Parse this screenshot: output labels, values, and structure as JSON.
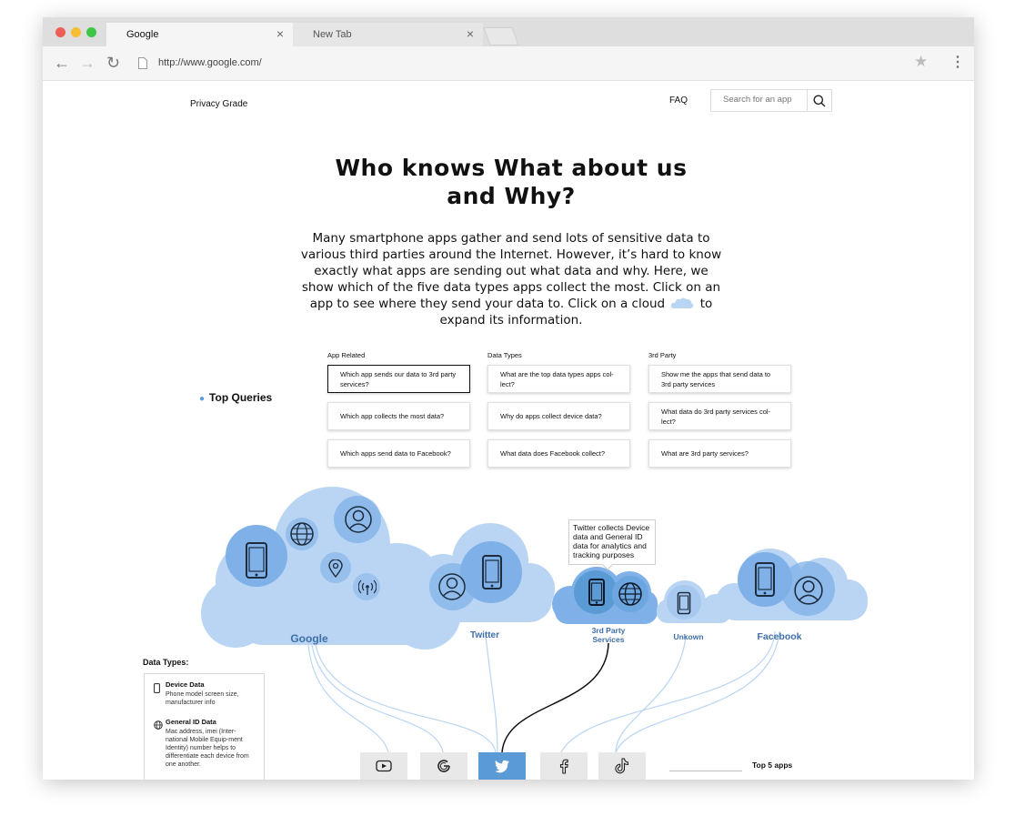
{
  "browser": {
    "tabs": [
      {
        "label": "Google",
        "close": "×"
      },
      {
        "label": "New Tab",
        "close": "×"
      }
    ],
    "url": "http://www.google.com/"
  },
  "header": {
    "brand": "Privacy Grade",
    "faq": "FAQ",
    "search_placeholder": "Search for an app"
  },
  "hero": {
    "title_line1": "Who knows What about us",
    "title_line2": "and Why?",
    "intro_part1": "Many smartphone apps gather and send lots of sensitive data to various third parties around the Internet. However, it’s hard to know exactly what apps are sending out what data and why. Here, we show which of the five data types apps collect the most. Click on an app to see where they send your data to. Click on a cloud",
    "intro_part2": "to expand its information."
  },
  "queries": {
    "title": "Top Queries",
    "columns": [
      {
        "heading": "App Related",
        "items": [
          "Which app sends our data to 3rd party services?",
          "Which app collects the most data?",
          "Which apps send data to Facebook?"
        ]
      },
      {
        "heading": "Data Types",
        "items": [
          "What are the top data types apps col-lect?",
          "Why do apps collect device data?",
          "What data does Facebook collect?"
        ]
      },
      {
        "heading": "3rd Party",
        "items": [
          "Show me the apps that send data to 3rd party services",
          "What data do 3rd party services col-lect?",
          "What are 3rd party services?"
        ]
      }
    ]
  },
  "clouds": {
    "labels": [
      "Google",
      "Twitter",
      "3rd Party Services",
      "Unkown",
      "Facebook"
    ],
    "tooltip": "Twitter collects Device data and General ID data for analytics and tracking purposes"
  },
  "data_types": {
    "title": "Data Types:",
    "items": [
      {
        "name": "Device Data",
        "desc": "Phone model screen size, manufacturer info",
        "icon": "phone-icon"
      },
      {
        "name": "General ID Data",
        "desc": "Mac address, imei (Inter-national Mobile Equip-ment Identity) number helps to differentiate each device from one another.",
        "icon": "globe-icon"
      }
    ]
  },
  "apps": {
    "icons": [
      "youtube-icon",
      "google-icon",
      "twitter-icon",
      "facebook-icon",
      "tiktok-icon"
    ],
    "selected": "twitter-icon",
    "top5_label": "Top 5 apps"
  },
  "colors": {
    "cloud": "#b9d5f3",
    "cloud_dark": "#7fb0e8",
    "accent": "#5b9bd5",
    "label": "#3e6fa9"
  }
}
